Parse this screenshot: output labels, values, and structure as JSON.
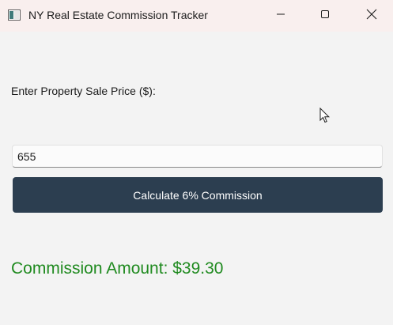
{
  "window": {
    "title": "NY Real Estate Commission Tracker",
    "controls": {
      "minimize_icon": "minimize-icon",
      "maximize_icon": "maximize-icon",
      "close_icon": "close-icon"
    }
  },
  "form": {
    "prompt": "Enter Property Sale Price ($):",
    "price_value": "655",
    "calculate_label": "Calculate 6% Commission"
  },
  "result": {
    "text": "Commission Amount: $39.30"
  },
  "colors": {
    "titlebar": "#f9efee",
    "background": "#f3f3f3",
    "button": "#2c3e50",
    "button_text": "#ffffff",
    "result_text": "#1f8a1f"
  }
}
